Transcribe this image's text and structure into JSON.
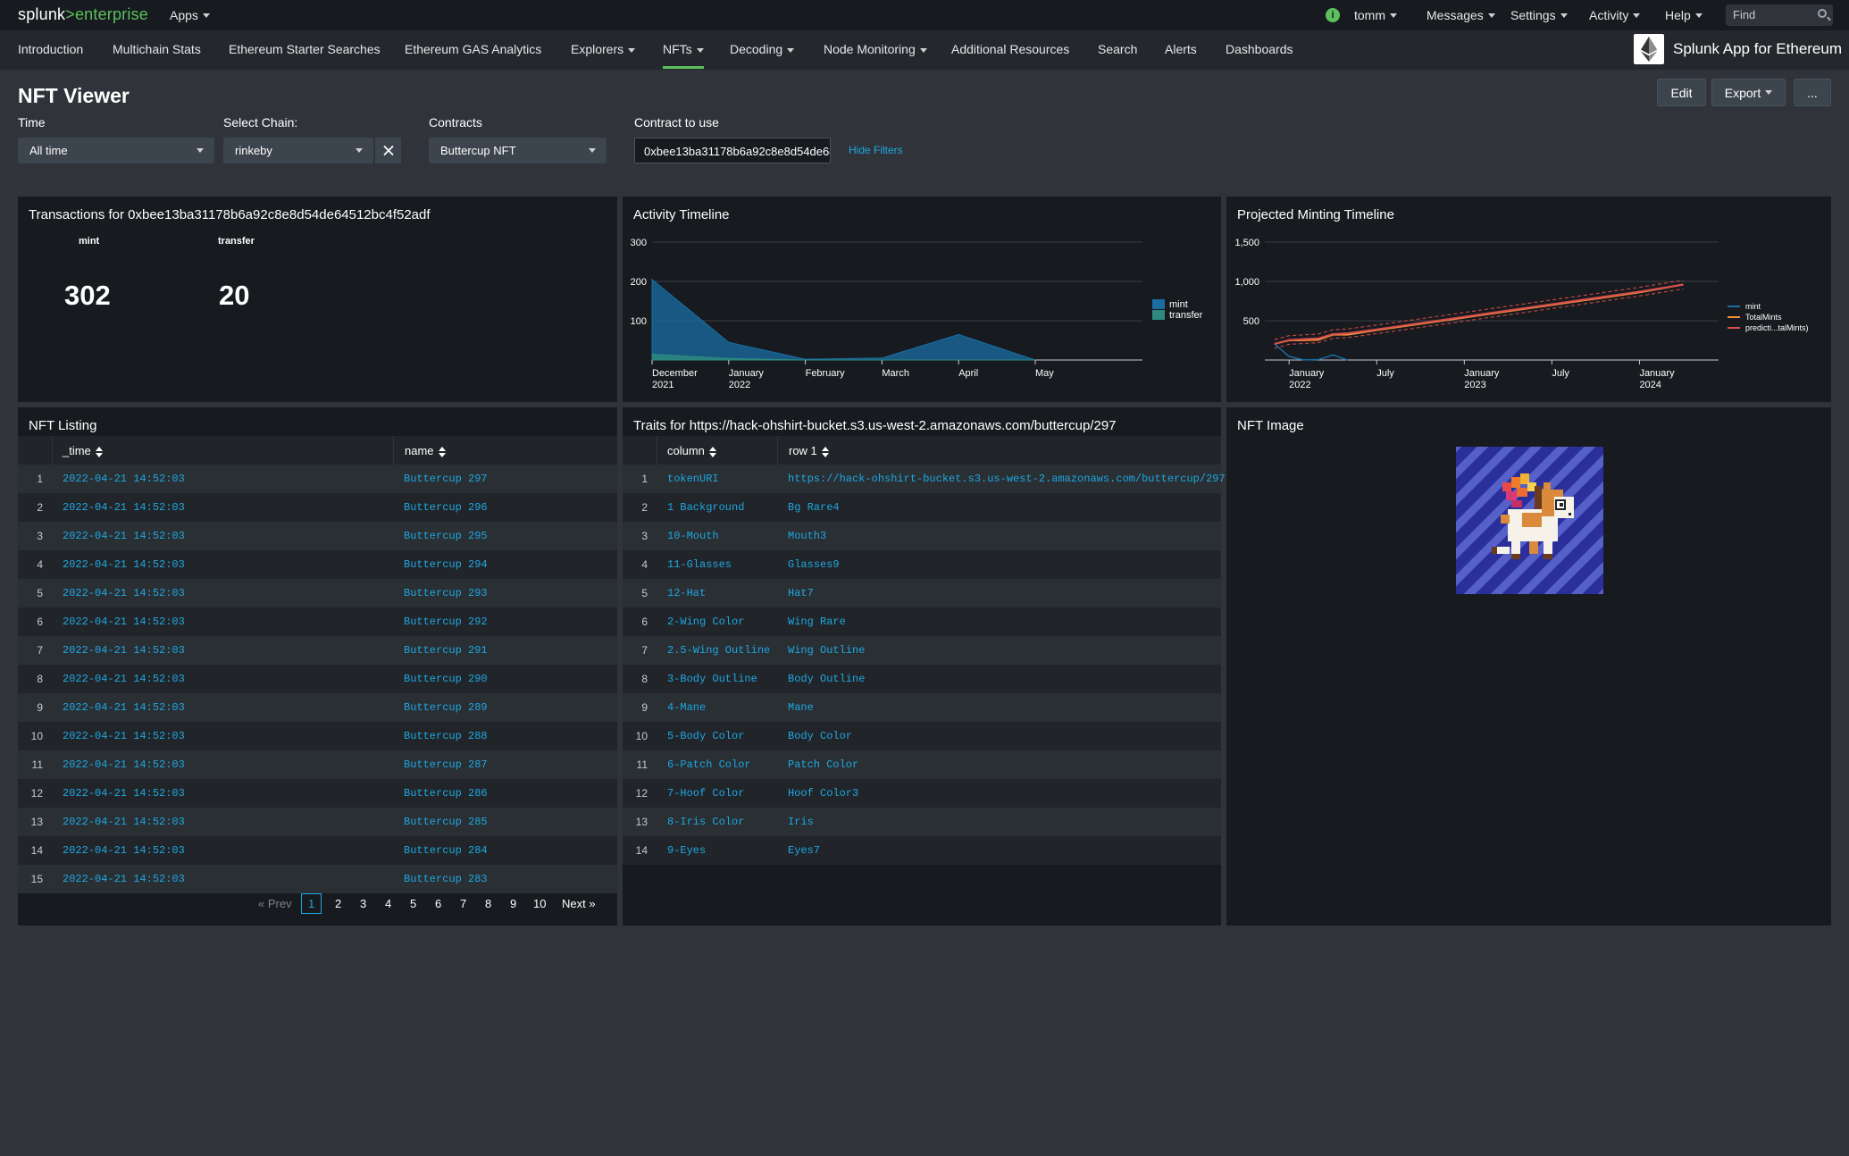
{
  "topbar": {
    "brand_a": "splunk",
    "brand_b": ">enterprise",
    "apps": "Apps",
    "user": "tomm",
    "messages": "Messages",
    "settings": "Settings",
    "activity": "Activity",
    "help": "Help",
    "find_placeholder": "Find"
  },
  "nav": {
    "items": [
      "Introduction",
      "Multichain Stats",
      "Ethereum Starter Searches",
      "Ethereum GAS Analytics",
      "Explorers",
      "NFTs",
      "Decoding",
      "Node Monitoring",
      "Additional Resources",
      "Search",
      "Alerts",
      "Dashboards"
    ],
    "app_title": "Splunk App for Ethereum"
  },
  "header": {
    "title": "NFT Viewer",
    "edit": "Edit",
    "export": "Export",
    "more": "..."
  },
  "filters": {
    "time_label": "Time",
    "time_value": "All time",
    "chain_label": "Select Chain:",
    "chain_value": "rinkeby",
    "contracts_label": "Contracts",
    "contracts_value": "Buttercup NFT",
    "contract_label": "Contract to use",
    "contract_value": "0xbee13ba31178b6a92c8e8d54de64512bc4f52adf",
    "hide_filters": "Hide Filters"
  },
  "transactions": {
    "title": "Transactions for 0xbee13ba31178b6a92c8e8d54de64512bc4f52adf",
    "mint_label": "mint",
    "mint_value": "302",
    "transfer_label": "transfer",
    "transfer_value": "20"
  },
  "activity_timeline": {
    "title": "Activity Timeline",
    "y_ticks": [
      "300",
      "200",
      "100"
    ],
    "x_ticks": [
      [
        "December",
        "2021"
      ],
      [
        "January",
        "2022"
      ],
      [
        "February",
        ""
      ],
      [
        "March",
        ""
      ],
      [
        "April",
        ""
      ],
      [
        "May",
        ""
      ]
    ],
    "legend": [
      "mint",
      "transfer"
    ]
  },
  "projected_timeline": {
    "title": "Projected Minting Timeline",
    "y_ticks": [
      "1,500",
      "1,000",
      "500"
    ],
    "x_ticks": [
      [
        "January",
        "2022"
      ],
      [
        "July",
        ""
      ],
      [
        "January",
        "2023"
      ],
      [
        "July",
        ""
      ],
      [
        "January",
        "2024"
      ]
    ],
    "legend": [
      "mint",
      "TotalMints",
      "predicti...talMints)"
    ]
  },
  "chart_data": [
    {
      "type": "area",
      "title": "Activity Timeline",
      "x": [
        "2021-12",
        "2022-01",
        "2022-02",
        "2022-03",
        "2022-04",
        "2022-05"
      ],
      "series": [
        {
          "name": "mint",
          "values": [
            205,
            45,
            2,
            5,
            65,
            0
          ]
        },
        {
          "name": "transfer",
          "values": [
            15,
            4,
            0,
            0,
            0,
            0
          ]
        }
      ],
      "ylim": [
        0,
        300
      ],
      "colors": [
        "#1a6ea4",
        "#2e8a80"
      ]
    },
    {
      "type": "line",
      "title": "Projected Minting Timeline",
      "x": [
        "2021-12",
        "2022-01",
        "2022-02",
        "2022-03",
        "2022-04",
        "2022-05",
        "2022-07",
        "2023-01",
        "2023-07",
        "2024-01",
        "2024-04"
      ],
      "series": [
        {
          "name": "mint",
          "values": [
            205,
            45,
            2,
            5,
            65,
            0,
            null,
            null,
            null,
            null,
            null
          ]
        },
        {
          "name": "TotalMints",
          "values": [
            205,
            250,
            252,
            257,
            322,
            322,
            380,
            540,
            700,
            860,
            960
          ]
        },
        {
          "name": "predicti...talMints)",
          "values": [
            205,
            255,
            265,
            275,
            330,
            340,
            390,
            550,
            710,
            870,
            960
          ]
        }
      ],
      "ylim": [
        0,
        1500
      ],
      "colors": [
        "#1a6ea4",
        "#f58f39",
        "#d94e4e"
      ]
    }
  ],
  "nft_listing": {
    "title": "NFT Listing",
    "col_time": "_time",
    "col_name": "name",
    "rows": [
      [
        "1",
        "2022-04-21 14:52:03",
        "Buttercup 297"
      ],
      [
        "2",
        "2022-04-21 14:52:03",
        "Buttercup 296"
      ],
      [
        "3",
        "2022-04-21 14:52:03",
        "Buttercup 295"
      ],
      [
        "4",
        "2022-04-21 14:52:03",
        "Buttercup 294"
      ],
      [
        "5",
        "2022-04-21 14:52:03",
        "Buttercup 293"
      ],
      [
        "6",
        "2022-04-21 14:52:03",
        "Buttercup 292"
      ],
      [
        "7",
        "2022-04-21 14:52:03",
        "Buttercup 291"
      ],
      [
        "8",
        "2022-04-21 14:52:03",
        "Buttercup 290"
      ],
      [
        "9",
        "2022-04-21 14:52:03",
        "Buttercup 289"
      ],
      [
        "10",
        "2022-04-21 14:52:03",
        "Buttercup 288"
      ],
      [
        "11",
        "2022-04-21 14:52:03",
        "Buttercup 287"
      ],
      [
        "12",
        "2022-04-21 14:52:03",
        "Buttercup 286"
      ],
      [
        "13",
        "2022-04-21 14:52:03",
        "Buttercup 285"
      ],
      [
        "14",
        "2022-04-21 14:52:03",
        "Buttercup 284"
      ],
      [
        "15",
        "2022-04-21 14:52:03",
        "Buttercup 283"
      ]
    ],
    "pager": {
      "prev": "« Prev",
      "pages": [
        "1",
        "2",
        "3",
        "4",
        "5",
        "6",
        "7",
        "8",
        "9",
        "10"
      ],
      "next": "Next »"
    }
  },
  "traits": {
    "title": "Traits for https://hack-ohshirt-bucket.s3.us-west-2.amazonaws.com/buttercup/297",
    "col_column": "column",
    "col_row1": "row 1",
    "rows": [
      [
        "1",
        "tokenURI",
        "https://hack-ohshirt-bucket.s3.us-west-2.amazonaws.com/buttercup/297"
      ],
      [
        "2",
        "1 Background",
        "Bg Rare4"
      ],
      [
        "3",
        "10-Mouth",
        "Mouth3"
      ],
      [
        "4",
        "11-Glasses",
        "Glasses9"
      ],
      [
        "5",
        "12-Hat",
        "Hat7"
      ],
      [
        "6",
        "2-Wing Color",
        "Wing Rare"
      ],
      [
        "7",
        "2.5-Wing Outline",
        "Wing Outline"
      ],
      [
        "8",
        "3-Body Outline",
        "Body Outline"
      ],
      [
        "9",
        "4-Mane",
        "Mane"
      ],
      [
        "10",
        "5-Body Color",
        "Body Color"
      ],
      [
        "11",
        "6-Patch Color",
        "Patch Color"
      ],
      [
        "12",
        "7-Hoof Color",
        "Hoof Color3"
      ],
      [
        "13",
        "8-Iris Color",
        "Iris"
      ],
      [
        "14",
        "9-Eyes",
        "Eyes7"
      ]
    ]
  },
  "nft_image": {
    "title": "NFT Image"
  }
}
